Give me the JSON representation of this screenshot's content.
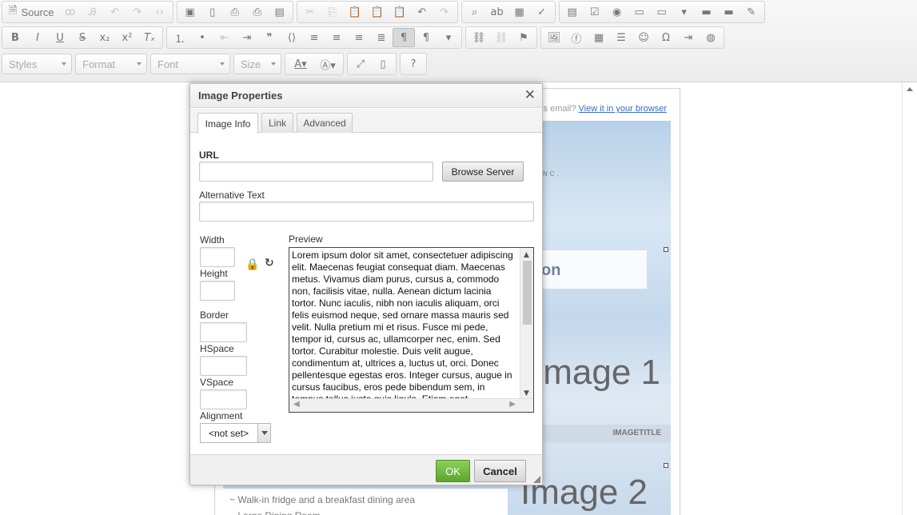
{
  "toolbar": {
    "source_label": "Source",
    "combos": {
      "styles": "Styles",
      "format": "Format",
      "font": "Font",
      "size": "Size"
    }
  },
  "document": {
    "email_prefix": "s email?",
    "view_link": "View it in your browser",
    "inc_text": "NC.",
    "band_text": "on",
    "image1": "Image 1",
    "imagetitle": "IMAGETITLE",
    "image2": "Image 2",
    "bullet1": "~ Walk-in fridge and a breakfast dining area",
    "bullet2": "~ Large Dining Room"
  },
  "dialog": {
    "title": "Image Properties",
    "close_glyph": "✕",
    "tabs": [
      "Image Info",
      "Link",
      "Advanced"
    ],
    "url_label": "URL",
    "url_value": "",
    "browse_label": "Browse Server",
    "alt_label": "Alternative Text",
    "alt_value": "",
    "width_label": "Width",
    "height_label": "Height",
    "border_label": "Border",
    "hspace_label": "HSpace",
    "vspace_label": "VSpace",
    "alignment_label": "Alignment",
    "alignment_value": "<not set>",
    "preview_label": "Preview",
    "preview_text": "Lorem ipsum dolor sit amet, consectetuer adipiscing elit. Maecenas feugiat consequat diam. Maecenas metus. Vivamus diam purus, cursus a, commodo non, facilisis vitae, nulla. Aenean dictum lacinia tortor. Nunc iaculis, nibh non iaculis aliquam, orci felis euismod neque, sed ornare massa mauris sed velit. Nulla pretium mi et risus. Fusce mi pede, tempor id, cursus ac, ullamcorper nec, enim. Sed tortor. Curabitur molestie. Duis velit augue, condimentum at, ultrices a, luctus ut, orci. Donec pellentesque egestas eros. Integer cursus, augue in cursus faucibus, eros pede bibendum sem, in tempus tellus justo quis ligula. Etiam eget",
    "ok_label": "OK",
    "cancel_label": "Cancel"
  },
  "colors": {
    "ok_green": "#6bb539",
    "link_blue": "#3a6bc8"
  }
}
